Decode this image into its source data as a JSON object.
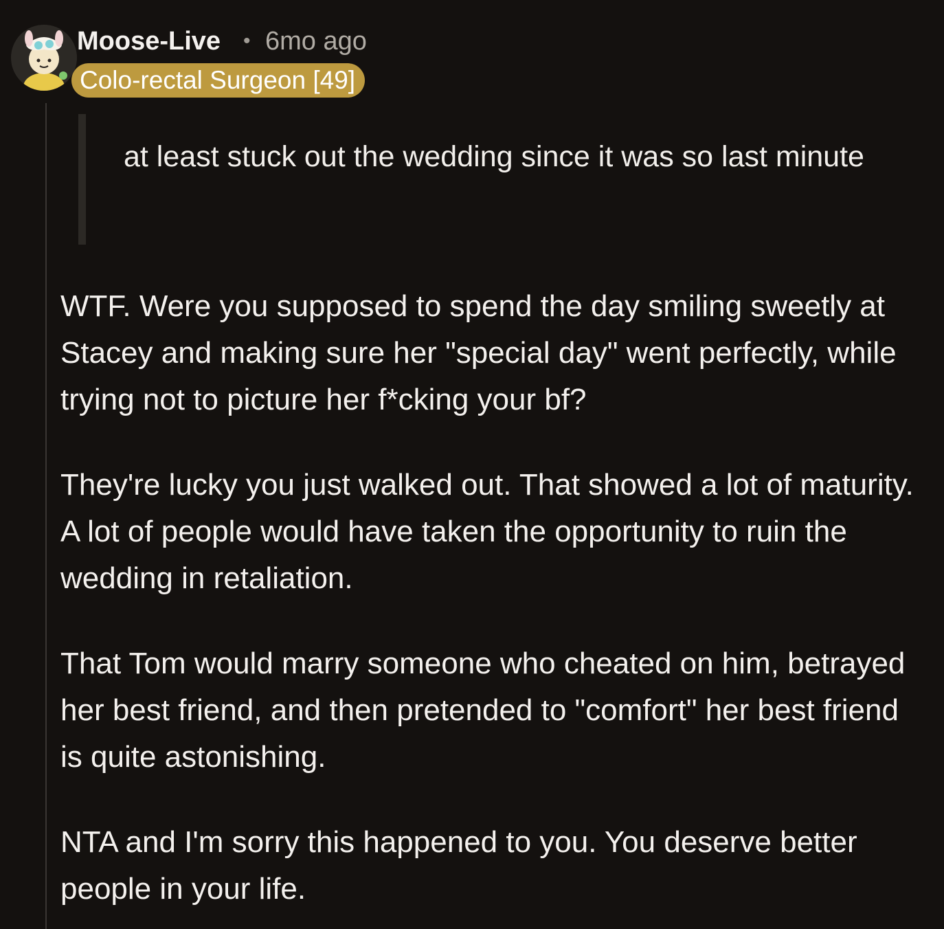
{
  "comment": {
    "author": "Moose-Live",
    "separator": "•",
    "time": "6mo ago",
    "flair": "Colo-rectal Surgeon [49]",
    "quote": "at least stuck out the wedding since it was so last minute",
    "paragraphs": [
      "WTF. Were you supposed to spend the day smiling sweetly at Stacey and making sure her \"special day\" went perfectly, while trying not to picture her f*cking your bf?",
      "They're lucky you just walked out. That showed a lot of maturity. A lot of people would have taken the opportunity to ruin the wedding in retaliation.",
      "That Tom would marry someone who cheated on him, betrayed her best friend, and then pretended to \"comfort\" her best friend is quite astonishing.",
      "NTA and I'm sorry this happened to you. You deserve better people in your life."
    ]
  },
  "colors": {
    "background": "#14110f",
    "flair_background": "#bd9a3f",
    "thread_line": "#3a3633",
    "quote_bar": "#2c2925",
    "text": "#f4f1ee",
    "muted_text": "#b1aca5"
  },
  "icons": {
    "avatar": "avatar-snoo-icon"
  }
}
